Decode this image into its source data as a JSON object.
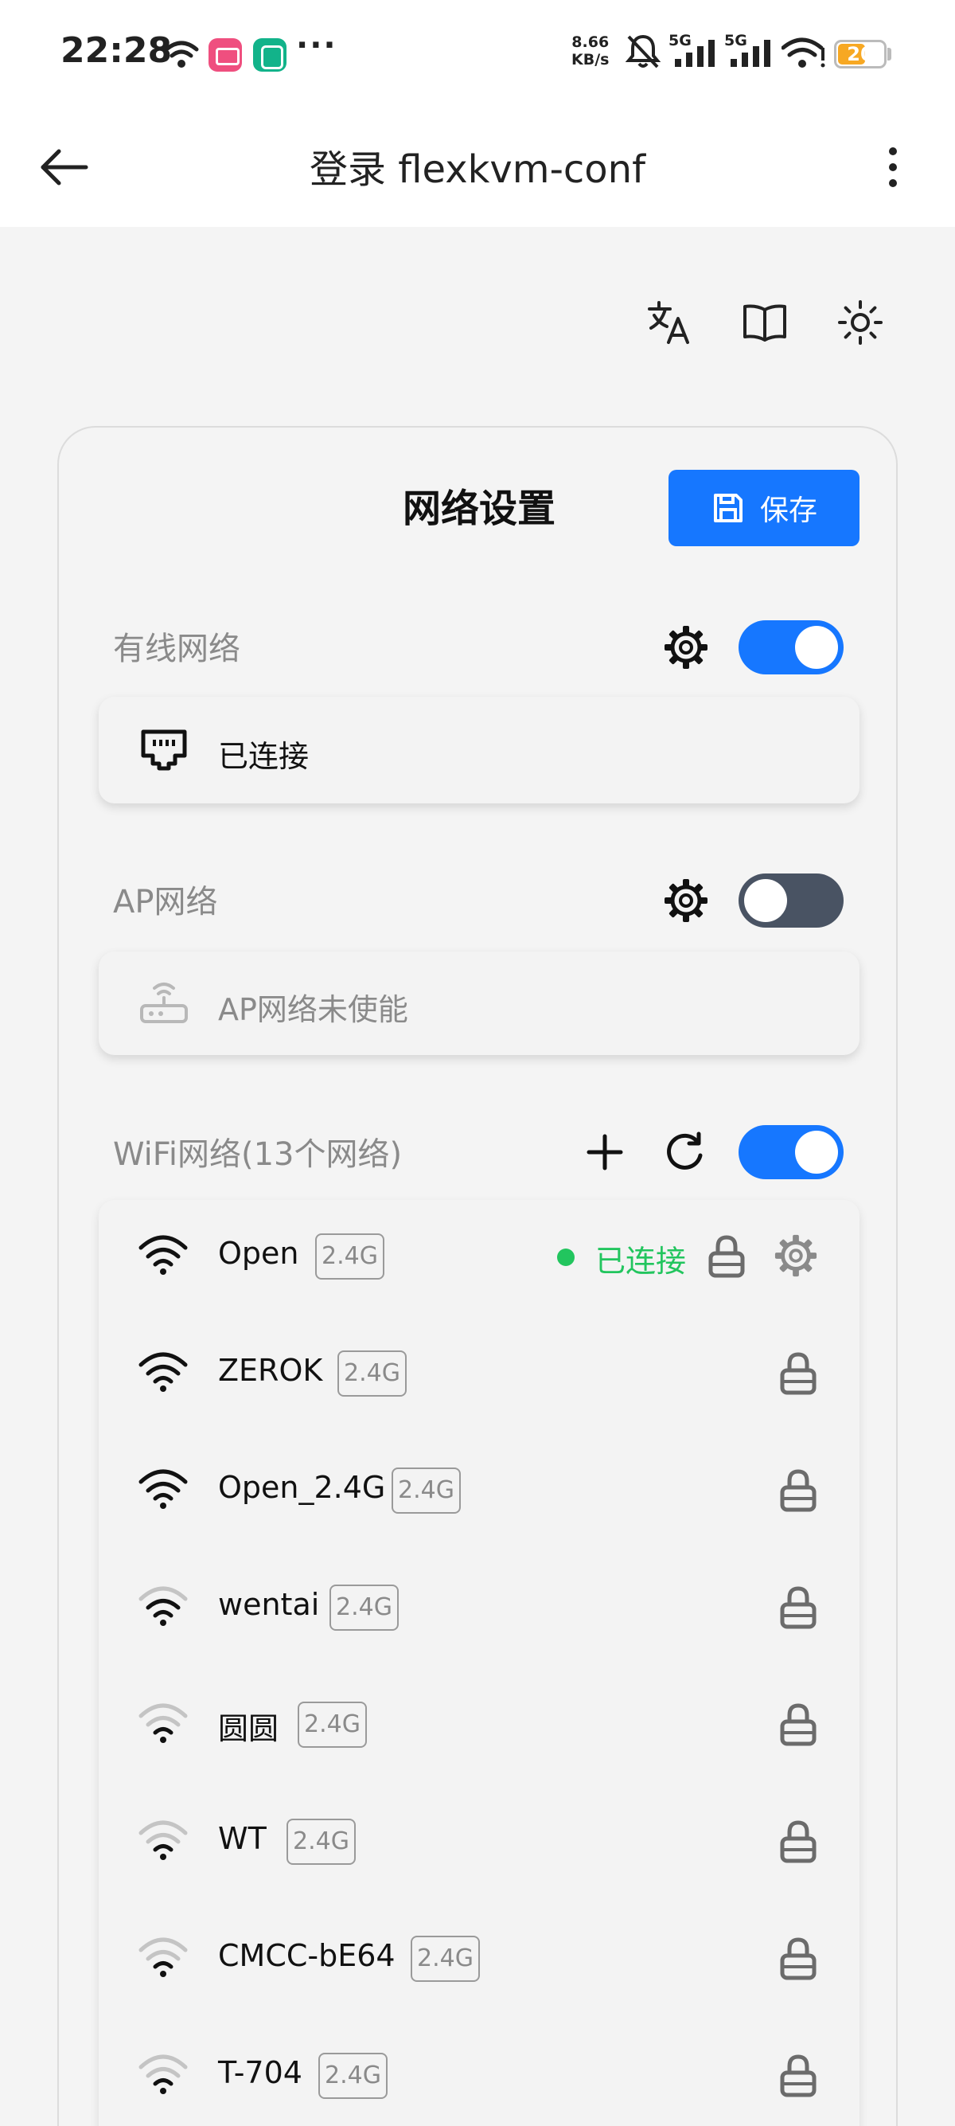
{
  "status_bar": {
    "time": "22:28",
    "more": "···",
    "net_speed_value": "8.66",
    "net_speed_unit": "KB/s",
    "sim1_label": "5G",
    "sim2_label": "5G",
    "battery": "20",
    "battery_level_percent": 20
  },
  "app_bar": {
    "title": "登录 flexkvm-conf"
  },
  "toolbar_icons": [
    "translate-icon",
    "book-icon",
    "sun-icon"
  ],
  "card": {
    "title": "网络设置",
    "save_label": "保存"
  },
  "wired": {
    "label": "有线网络",
    "enabled": true,
    "status": "已连接"
  },
  "ap": {
    "label": "AP网络",
    "enabled": false,
    "status": "AP网络未使能"
  },
  "wifi": {
    "label": "WiFi网络(13个网络)",
    "enabled": true,
    "connected_label": "已连接",
    "networks": [
      {
        "ssid": "Open",
        "band": "2.4G",
        "strength": "strong",
        "connected": true
      },
      {
        "ssid": "ZEROK",
        "band": "2.4G",
        "strength": "strong",
        "connected": false
      },
      {
        "ssid": "Open_2.4G",
        "band": "2.4G",
        "strength": "strong",
        "connected": false
      },
      {
        "ssid": "wentai",
        "band": "2.4G",
        "strength": "medium",
        "connected": false
      },
      {
        "ssid": "圆圆",
        "band": "2.4G",
        "strength": "weak",
        "connected": false
      },
      {
        "ssid": "WT",
        "band": "2.4G",
        "strength": "weak",
        "connected": false
      },
      {
        "ssid": "CMCC-bE64",
        "band": "2.4G",
        "strength": "weak",
        "connected": false
      },
      {
        "ssid": "T-704",
        "band": "2.4G",
        "strength": "weak",
        "connected": false
      }
    ]
  },
  "colors": {
    "primary": "#1677ff",
    "connected": "#22c55e",
    "toggle_off": "#495363",
    "battery": "#f7a823"
  }
}
